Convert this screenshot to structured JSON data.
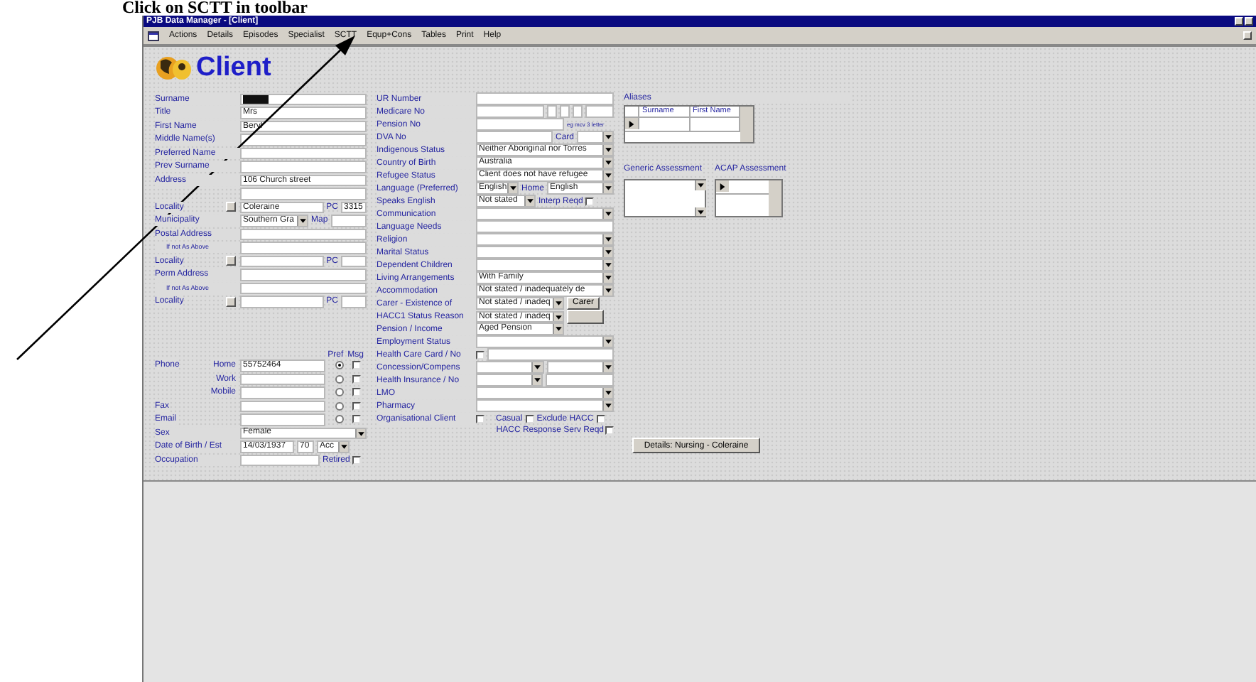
{
  "heading": "Click on SCTT in toolbar",
  "window": {
    "title": "PJB Data Manager - [Client]"
  },
  "menu": [
    "Actions",
    "Details",
    "Episodes",
    "Specialist",
    "SCTT",
    "Equp+Cons",
    "Tables",
    "Print",
    "Help"
  ],
  "form_title": "Client",
  "left_rows": [
    {
      "kind": "field",
      "label": "Surname",
      "highlighted": true
    },
    {
      "kind": "field",
      "label": "Title",
      "value": "Mrs"
    },
    {
      "kind": "field",
      "label": "First Name",
      "value": "Beryl"
    },
    {
      "kind": "field",
      "label": "Middle Name(s)"
    },
    {
      "kind": "field",
      "label": "Preferred Name"
    },
    {
      "kind": "field",
      "label": "Prev Surname"
    },
    {
      "kind": "field",
      "label": "Address",
      "value": "106 Church street"
    },
    {
      "kind": "field"
    },
    {
      "kind": "locality",
      "label": "Locality",
      "value": "Coleraine",
      "pc_label": "PC",
      "pc_value": "3315"
    },
    {
      "kind": "municipality",
      "label": "Municipality",
      "value": "Southern Gra",
      "map_label": "Map"
    },
    {
      "kind": "field",
      "label": "Postal Address"
    },
    {
      "kind": "field",
      "note": "If not As Above"
    },
    {
      "kind": "locality",
      "label": "Locality",
      "pc_label": "PC"
    },
    {
      "kind": "field",
      "label": "Perm Address"
    },
    {
      "kind": "field",
      "note": "If not As Above"
    },
    {
      "kind": "locality",
      "label": "Locality",
      "pc_label": "PC"
    }
  ],
  "contact_header": {
    "pref": "Pref",
    "msg": "Msg"
  },
  "contacts": [
    {
      "label": "Phone",
      "sublabel": "Home",
      "value": "55752464",
      "pref_selected": true,
      "msg_checked": false
    },
    {
      "sublabel": "Work",
      "pref_selected": false,
      "msg_checked": false
    },
    {
      "sublabel": "Mobile",
      "pref_selected": false,
      "msg_checked": false
    },
    {
      "label": "Fax",
      "pref_selected": false,
      "msg_checked": false
    },
    {
      "label": "Email",
      "pref_selected": false,
      "msg_checked": false
    }
  ],
  "sex": {
    "label": "Sex",
    "value": "Female"
  },
  "dob": {
    "label": "Date of Birth / Est",
    "value": "14/03/1937",
    "age": "70",
    "accuracy": "Acc"
  },
  "occupation": {
    "label": "Occupation",
    "check_label": "Retired",
    "checked": false
  },
  "right_rows": [
    {
      "kind": "field",
      "label": "UR Number"
    },
    {
      "kind": "medicare",
      "label": "Medicare No"
    },
    {
      "kind": "pension",
      "label": "Pension No",
      "hint": "eg mcv 3 letter"
    },
    {
      "kind": "dva",
      "label": "DVA No",
      "card_label": "Card"
    },
    {
      "kind": "combo",
      "label": "Indigenous Status",
      "value": "Neither Aboriginal nor Torres"
    },
    {
      "kind": "combo",
      "label": "Country of Birth",
      "value": "Australia"
    },
    {
      "kind": "combo",
      "label": "Refugee Status",
      "value": "Client does not have refugee"
    },
    {
      "kind": "language",
      "label": "Language (Preferred)",
      "value": "English",
      "home_label": "Home",
      "home_value": "English"
    },
    {
      "kind": "speaks",
      "label": "Speaks English",
      "value": "Not stated",
      "interp_label": "Interp Reqd",
      "checked": false
    },
    {
      "kind": "combo",
      "label": "Communication"
    },
    {
      "kind": "field",
      "label": "Language Needs"
    },
    {
      "kind": "combo",
      "label": "Religion"
    },
    {
      "kind": "combo",
      "label": "Marital Status"
    },
    {
      "kind": "combo",
      "label": "Dependent Children"
    },
    {
      "kind": "combo",
      "label": "Living Arrangements",
      "value": "With Family"
    },
    {
      "kind": "combo",
      "label": "Accommodation",
      "value": "Not stated / inadequately de"
    },
    {
      "kind": "carer",
      "label": "Carer - Existence of",
      "value": "Not stated / inadeq",
      "button": "Carer"
    },
    {
      "kind": "carer",
      "label": "HACC1 Status Reason",
      "value": "Not stated / inadeq"
    },
    {
      "kind": "short_combo",
      "label": "Pension / Income",
      "value": "Aged Pension"
    },
    {
      "kind": "combo",
      "label": "Employment Status"
    },
    {
      "kind": "checkfield",
      "label": "Health Care Card / No",
      "checked": false
    },
    {
      "kind": "two_combo",
      "label": "Concession/Compens"
    },
    {
      "kind": "combo_field",
      "label": "Health Insurance / No"
    },
    {
      "kind": "combo",
      "label": "LMO"
    },
    {
      "kind": "combo",
      "label": "Pharmacy"
    },
    {
      "kind": "org",
      "label": "Organisational Client",
      "checked": false,
      "casual_label": "Casual",
      "casual_checked": false,
      "exclude_label": "Exclude HACC",
      "exclude_checked": false
    }
  ],
  "hacc_response": {
    "label": "HACC Response Serv Reqd",
    "checked": false
  },
  "aliases": {
    "title": "Aliases",
    "columns": [
      "Surname",
      "First Name"
    ]
  },
  "generic_assessment": {
    "title": "Generic Assessment"
  },
  "acap_assessment": {
    "title": "ACAP Assessment"
  },
  "details_button": "Details: Nursing - Coleraine"
}
